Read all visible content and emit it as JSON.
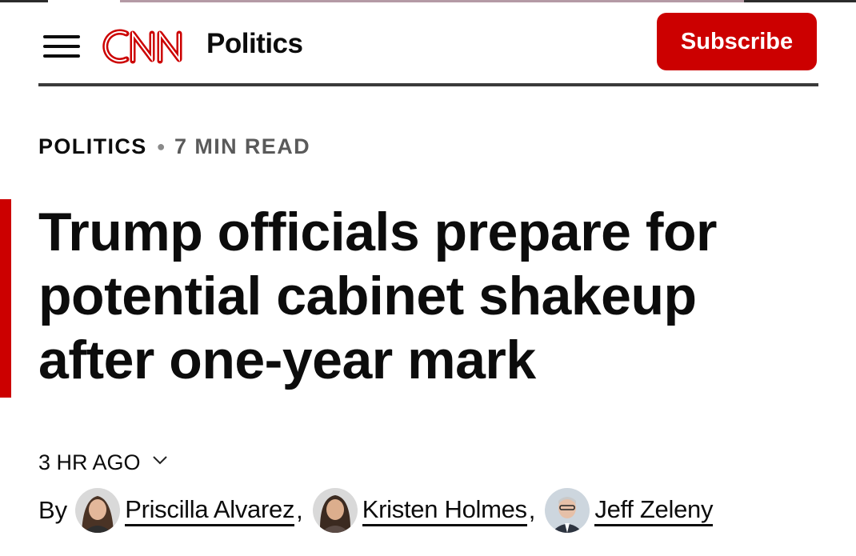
{
  "header": {
    "logo_text": "CNN",
    "section": "Politics",
    "subscribe_label": "Subscribe",
    "menu_icon": "hamburger-menu-icon",
    "brand_color": "#cc0000"
  },
  "article": {
    "category": "POLITICS",
    "read_time": "7 MIN READ",
    "headline": "Trump officials prepare for potential cabinet shakeup after one-year mark",
    "timestamp": "3 HR AGO",
    "byline_prefix": "By",
    "authors": [
      {
        "name": "Priscilla Alvarez"
      },
      {
        "name": "Kristen Holmes"
      },
      {
        "name": "Jeff Zeleny"
      }
    ]
  }
}
